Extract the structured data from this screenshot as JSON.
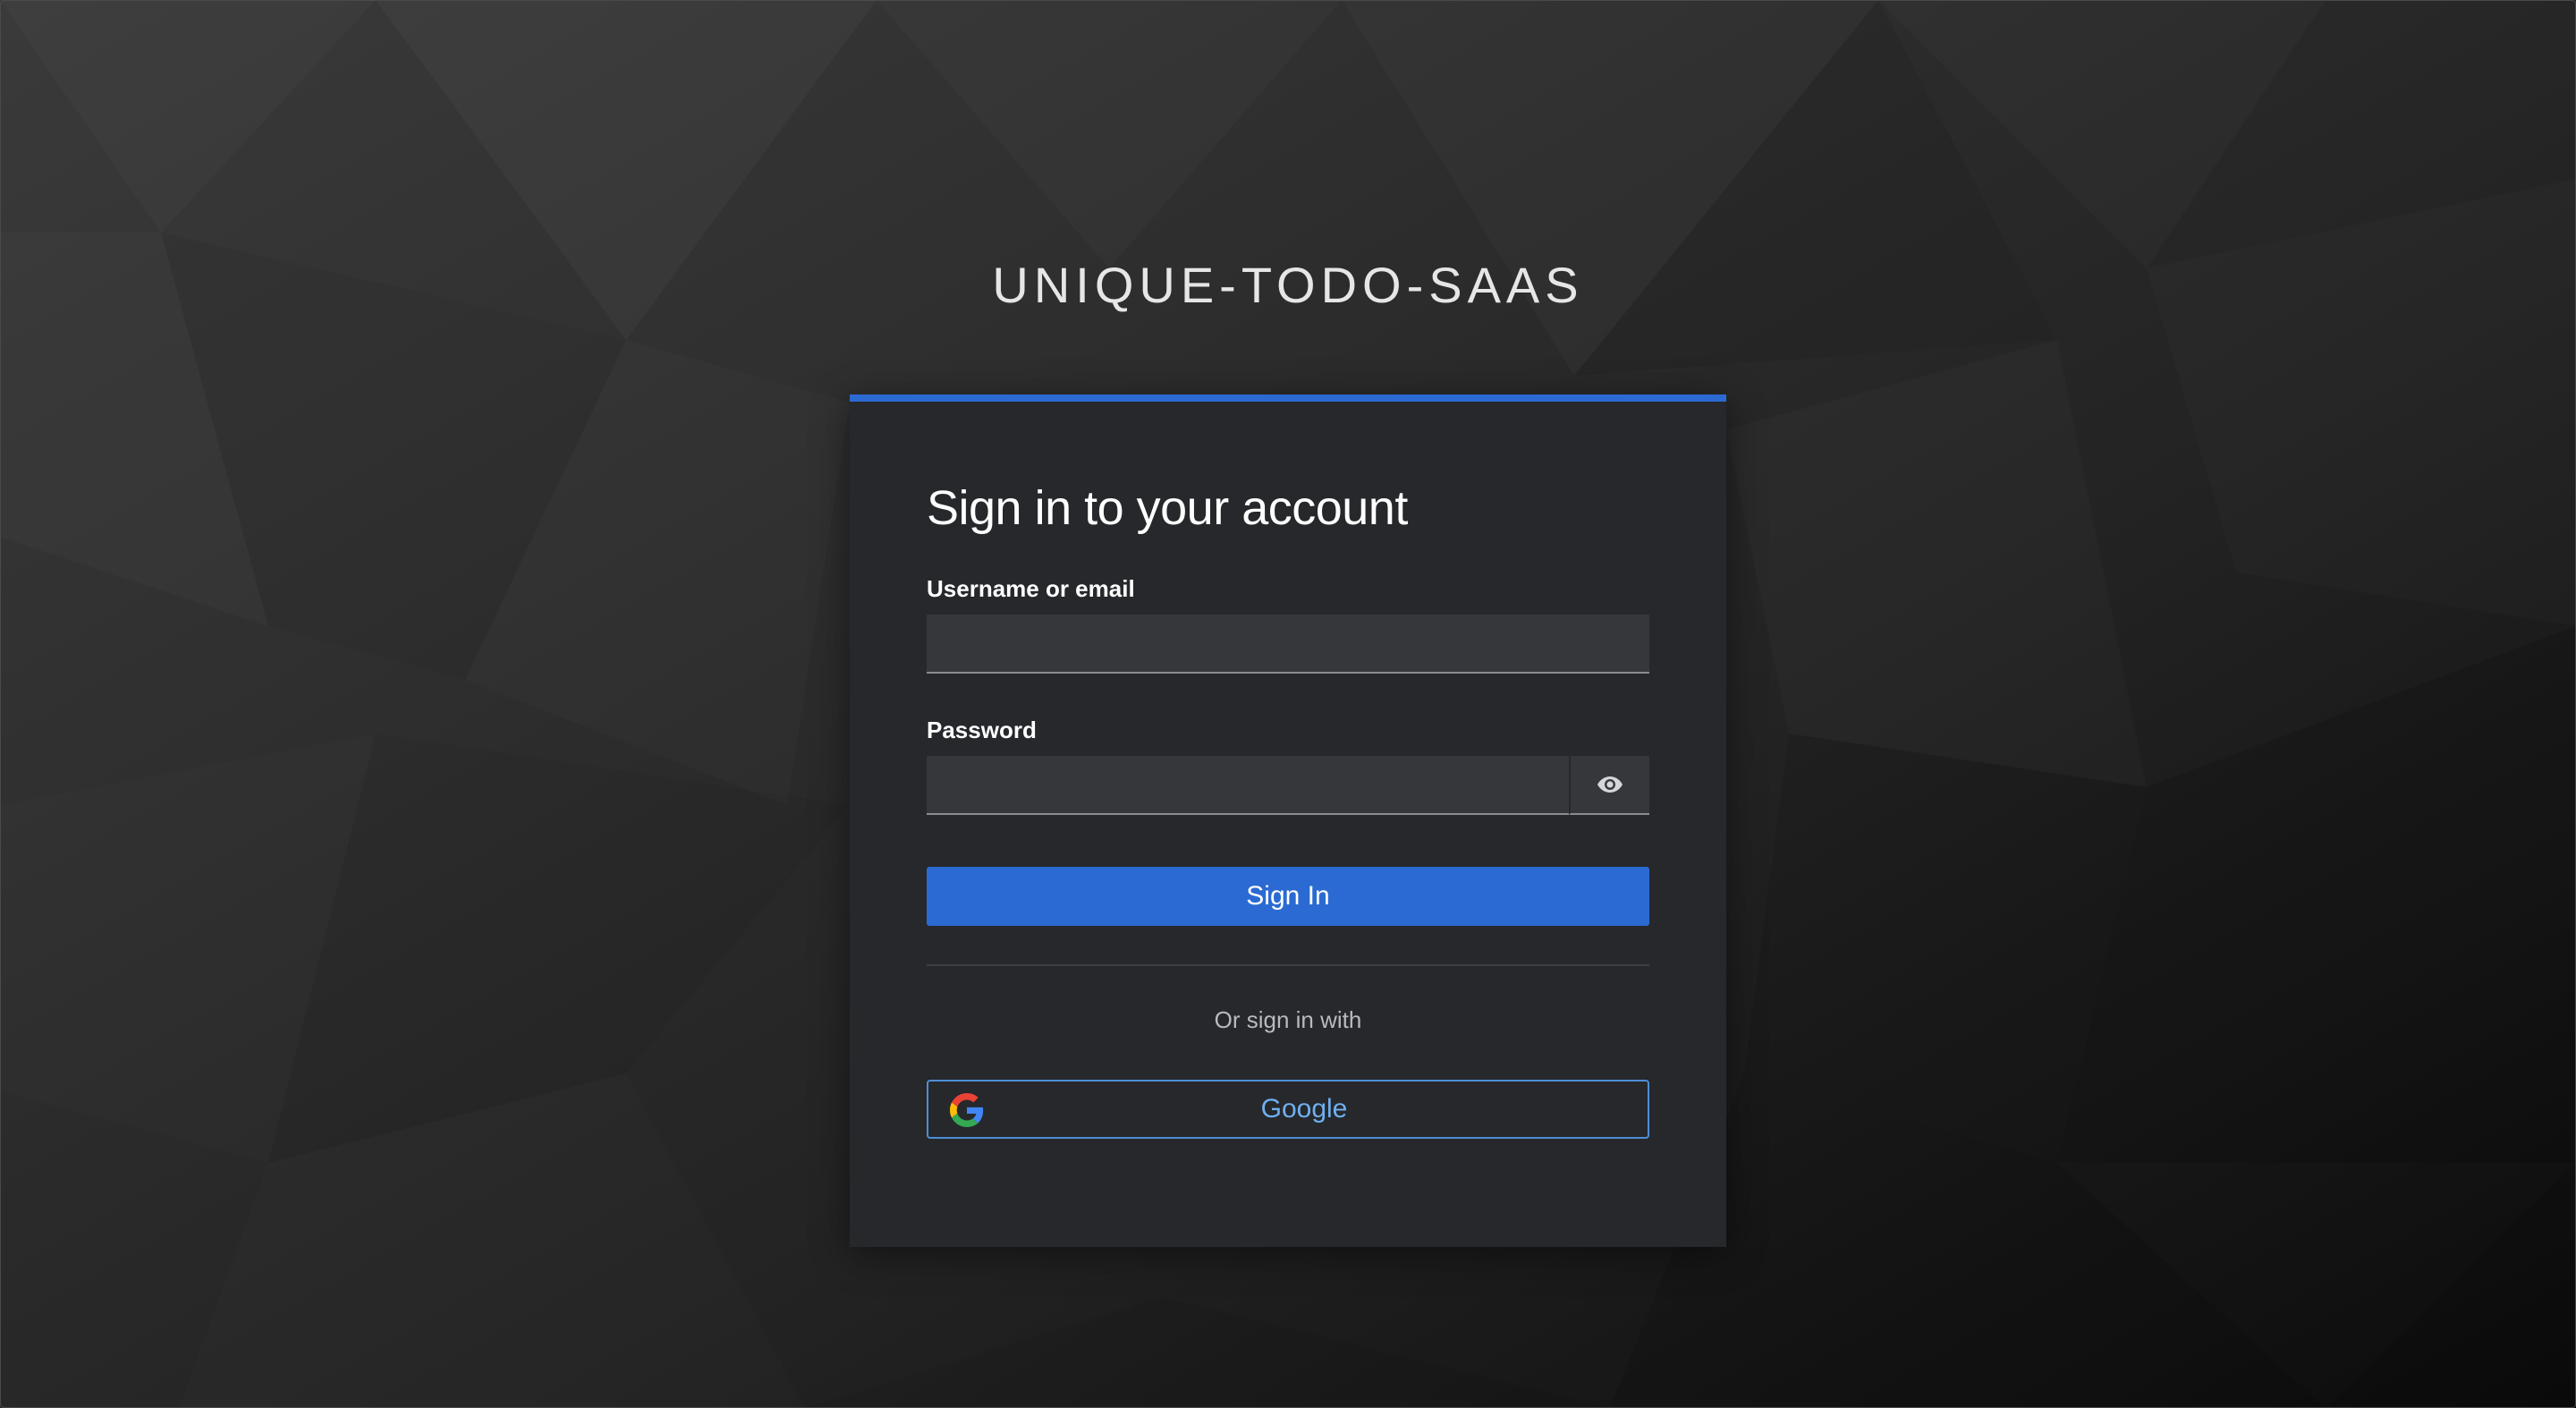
{
  "brand": {
    "title": "UNIQUE-TODO-SAAS"
  },
  "login": {
    "heading": "Sign in to your account",
    "username_label": "Username or email",
    "username_value": "",
    "username_placeholder": "",
    "password_label": "Password",
    "password_value": "",
    "password_placeholder": "",
    "show_password_icon": "eye-icon",
    "submit_label": "Sign In",
    "alt_text": "Or sign in with",
    "google_label": "Google",
    "google_icon": "google-logo-icon"
  },
  "colors": {
    "accent": "#2b6ad2",
    "card_bg": "#26282c",
    "input_bg": "#36373b",
    "link": "#6fb0ef"
  }
}
